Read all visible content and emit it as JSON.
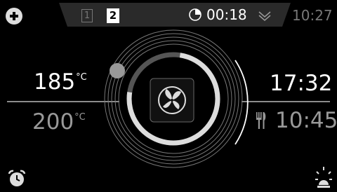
{
  "header": {
    "program_1": "1",
    "program_2": "2",
    "timer": "00:18",
    "clock": "10:27"
  },
  "left_panel": {
    "current_temp": "185",
    "set_temp": "200",
    "temp_unit": "°C"
  },
  "right_panel": {
    "end_time": "17:32",
    "cook_time": "10:45"
  },
  "center": {
    "mode_icon": "fan-icon",
    "progress": 0.75
  },
  "icons": {
    "add": "plus-icon",
    "timer": "timer-icon",
    "expand": "chevron-down-icon",
    "alarm": "alarm-clock-icon",
    "light": "light-bulb-icon",
    "cutlery": "cutlery-icon"
  },
  "colors": {
    "background": "#000000",
    "accent": "#ffffff",
    "muted": "#999999"
  }
}
